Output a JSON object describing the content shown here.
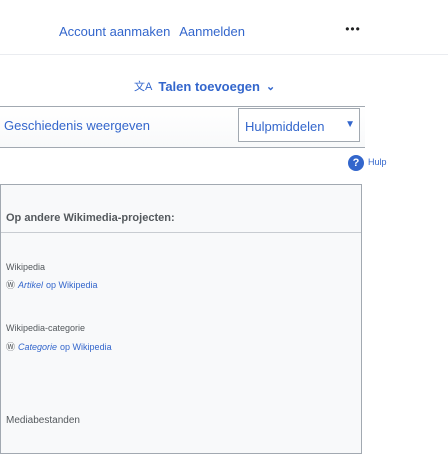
{
  "header": {
    "create_account": "Account aanmaken",
    "login": "Aanmelden",
    "more_icon": "ellipsis-icon"
  },
  "languages": {
    "label": "Talen toevoegen",
    "icon": "translate-icon"
  },
  "tabs": {
    "history": "Geschiedenis weergeven",
    "tools": "Hulpmiddelen"
  },
  "help": {
    "label": "Hulp",
    "icon": "help-icon"
  },
  "other_projects": {
    "title": "Op andere Wikimedia-projecten:",
    "sections": [
      {
        "label": "Wikipedia",
        "link_text": "Artikel",
        "link_suffix": "op Wikipedia"
      },
      {
        "label": "Wikipedia-categorie",
        "link_text": "Categorie",
        "link_suffix": "op Wikipedia"
      }
    ],
    "media": "Mediabestanden"
  },
  "colors": {
    "link": "#3366cc",
    "border": "#a2a9b1",
    "panel_bg": "#f8f9fa"
  }
}
